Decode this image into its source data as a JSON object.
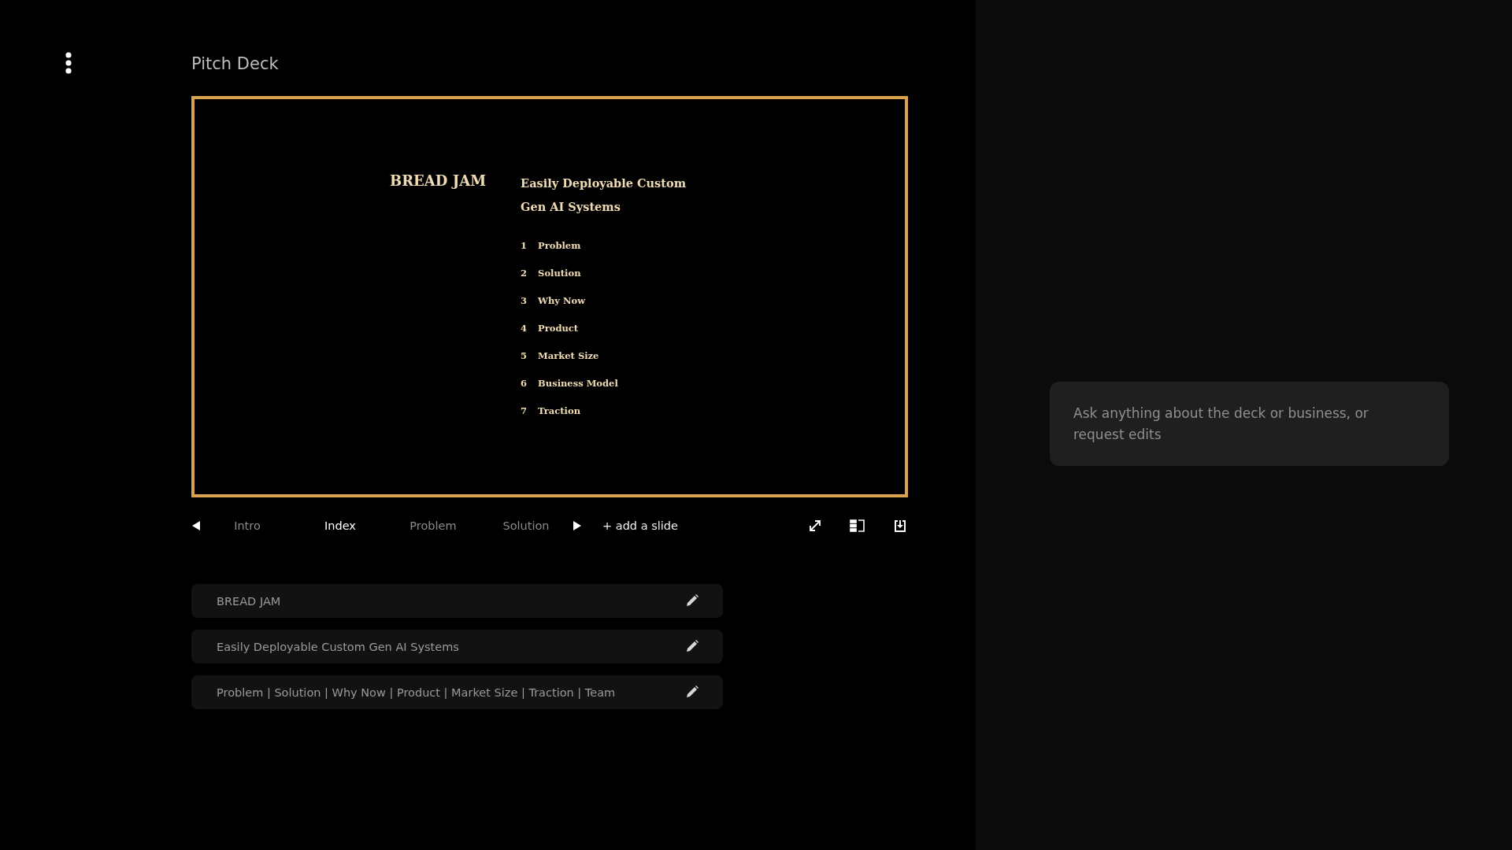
{
  "header": {
    "title": "Pitch Deck"
  },
  "slide": {
    "brand": "BREAD JAM",
    "headline_lines": [
      "Easily Deployable Custom",
      "Gen AI Systems"
    ],
    "agenda": [
      {
        "number": "1",
        "label": "Problem"
      },
      {
        "number": "2",
        "label": "Solution"
      },
      {
        "number": "3",
        "label": "Why Now"
      },
      {
        "number": "4",
        "label": "Product"
      },
      {
        "number": "5",
        "label": "Market Size"
      },
      {
        "number": "6",
        "label": "Business Model"
      },
      {
        "number": "7",
        "label": "Traction"
      }
    ]
  },
  "slide_tabs": [
    {
      "label": "Intro",
      "selected": false
    },
    {
      "label": "Index",
      "selected": true
    },
    {
      "label": "Problem",
      "selected": false
    },
    {
      "label": "Solution",
      "selected": false
    }
  ],
  "add_slide": "+ add a slide",
  "text_fields": [
    {
      "value": "BREAD JAM"
    },
    {
      "value": "Easily Deployable Custom Gen AI Systems"
    },
    {
      "value": "Problem | Solution | Why Now | Product | Market Size | Traction | Team"
    }
  ],
  "chat": {
    "placeholder": "Ask anything about the deck or business, or request edits"
  }
}
